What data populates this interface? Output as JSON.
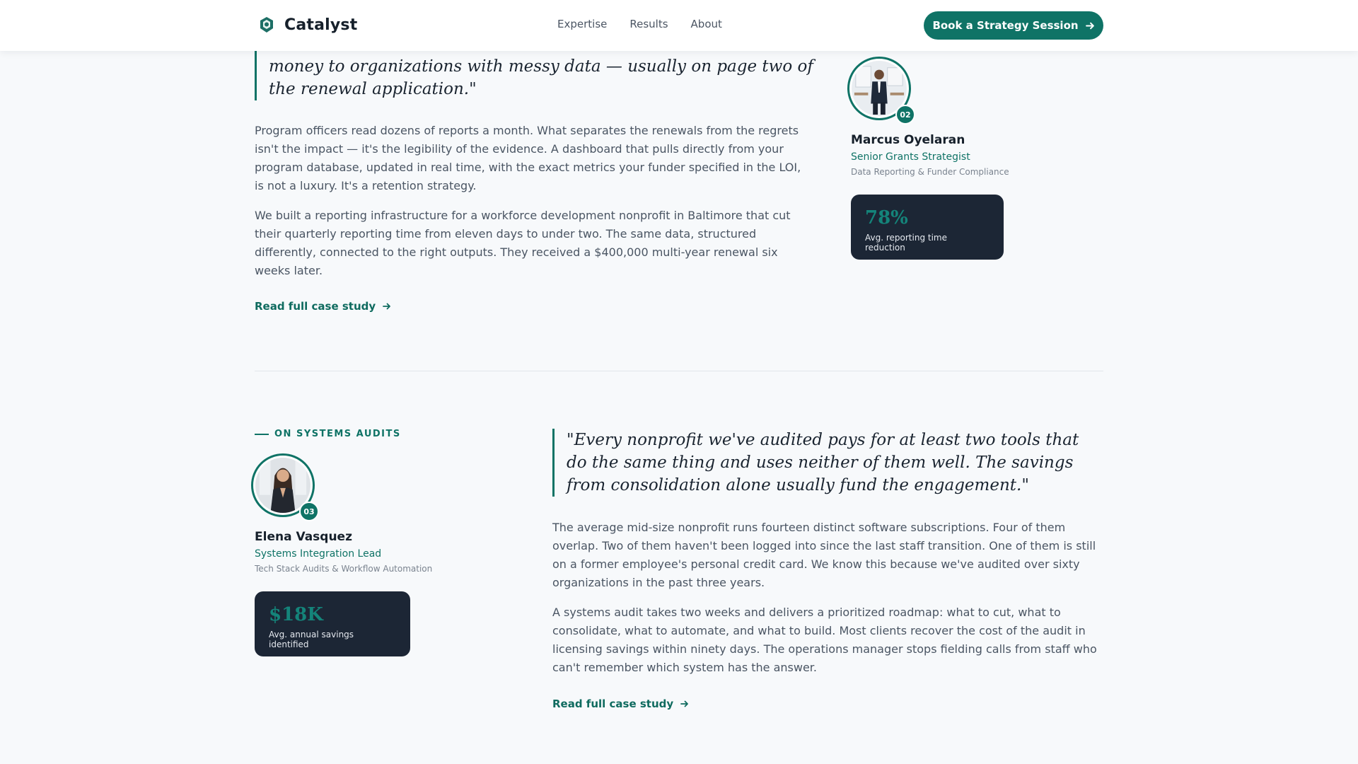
{
  "header": {
    "brand": "Catalyst",
    "nav": [
      "Expertise",
      "Results",
      "About"
    ],
    "cta_label": "Book a Strategy Session"
  },
  "section_top": {
    "quote_partial": "money to organizations with messy data — usually on page two of the renewal application.\"",
    "paragraphs": [
      "Program officers read dozens of reports a month. What separates the renewals from the regrets isn't the impact — it's the legibility of the evidence. A dashboard that pulls directly from your program database, updated in real time, with the exact metrics your funder specified in the LOI, is not a luxury. It's a retention strategy.",
      "We built a reporting infrastructure for a workforce development nonprofit in Baltimore that cut their quarterly reporting time from eleven days to under two. The same data, structured differently, connected to the right outputs. They received a $400,000 multi-year renewal six weeks later."
    ],
    "link_label": "Read full case study",
    "person": {
      "number": "02",
      "name": "Marcus Oyelaran",
      "role": "Senior Grants Strategist",
      "focus": "Data Reporting & Funder Compliance"
    },
    "stat": {
      "value": "78%",
      "label": "Avg. reporting time reduction"
    }
  },
  "section_bottom": {
    "eyebrow": "ON SYSTEMS AUDITS",
    "quote": "\"Every nonprofit we've audited pays for at least two tools that do the same thing and uses neither of them well. The savings from consolidation alone usually fund the engagement.\"",
    "paragraphs": [
      "The average mid-size nonprofit runs fourteen distinct software subscriptions. Four of them overlap. Two of them haven't been logged into since the last staff transition. One of them is still on a former employee's personal credit card. We know this because we've audited over sixty organizations in the past three years.",
      "A systems audit takes two weeks and delivers a prioritized roadmap: what to cut, what to consolidate, what to automate, and what to build. Most clients recover the cost of the audit in licensing savings within ninety days. The operations manager stops fielding calls from staff who can't remember which system has the answer."
    ],
    "link_label": "Read full case study",
    "person": {
      "number": "03",
      "name": "Elena Vasquez",
      "role": "Systems Integration Lead",
      "focus": "Tech Stack Audits & Workflow Automation"
    },
    "stat": {
      "value": "$18K",
      "label": "Avg. annual savings identified"
    }
  },
  "icons": {
    "logo": "catalyst-logo-icon",
    "arrow": "arrow-right-icon"
  },
  "colors": {
    "accent": "#0f7366",
    "stat_card_bg": "#1c2635",
    "page_bg": "#f7f9fb"
  }
}
